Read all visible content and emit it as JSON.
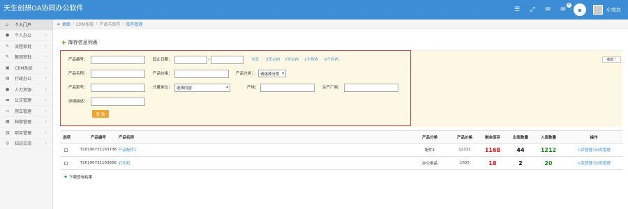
{
  "app": {
    "title": "天生创想OA协同办公软件",
    "username": "小龙女",
    "mail_badge": "0"
  },
  "sidebar": {
    "items": [
      {
        "label": "个人门户",
        "icon": "home-icon"
      },
      {
        "label": "个人办公",
        "icon": "user-icon"
      },
      {
        "label": "流程审批",
        "icon": "edit-icon"
      },
      {
        "label": "集团审批",
        "icon": "edit-icon"
      },
      {
        "label": "CRM系统",
        "icon": "crm-icon"
      },
      {
        "label": "行政办公",
        "icon": "building-icon"
      },
      {
        "label": "人力资源",
        "icon": "people-icon"
      },
      {
        "label": "公文管理",
        "icon": "folder-icon"
      },
      {
        "label": "用车管理",
        "icon": "car-icon"
      },
      {
        "label": "档案管理",
        "icon": "archive-icon"
      },
      {
        "label": "项目管理",
        "icon": "project-icon"
      },
      {
        "label": "知识交流",
        "icon": "knowledge-icon"
      }
    ]
  },
  "breadcrumb": {
    "items": [
      "桌面",
      "CRM系统",
      "产品与库存",
      "库存管理"
    ]
  },
  "main": {
    "section_title": "库存信息列表",
    "collapse_label": "收起"
  },
  "search": {
    "product_code_label": "产品编号：",
    "start_date_label": "起止日期：",
    "date_sep": "-",
    "quick_ranges": [
      "今天",
      "3天以内",
      "7天以内",
      "1个月内",
      "6个月内"
    ],
    "product_name_label": "产品名称：",
    "product_price_label": "产品价格：",
    "product_category_label": "产品分类：",
    "product_category_value": "请选择分类",
    "product_model_label": "产品型号：",
    "unit_label": "计量单位：",
    "unit_value": "选择内容",
    "origin_label": "产地：",
    "manufacturer_label": "生产厂商：",
    "detail_label": "详细描述：",
    "search_button": "查 询"
  },
  "table": {
    "headers": [
      "选项",
      "产品编号",
      "产品名称",
      "产品分类",
      "产品价格",
      "剩余库存",
      "出库数量",
      "入库数量",
      "操作"
    ],
    "rows": [
      {
        "code": "T20190731163736",
        "name": "产品配件1",
        "category": "配件1",
        "price": "12131",
        "stock": "1168",
        "out_qty": "44",
        "in_qty": "1212",
        "action_in": "入库管理",
        "action_sep": "|",
        "action_out": "出库管理"
      },
      {
        "code": "T20190731163656",
        "name": "打印机",
        "category": "办公用品",
        "price": "1655",
        "stock": "18",
        "out_qty": "2",
        "in_qty": "20",
        "action_in": "入库管理",
        "action_sep": "|",
        "action_out": "出库管理"
      }
    ],
    "download_label": "下载查询结果"
  }
}
